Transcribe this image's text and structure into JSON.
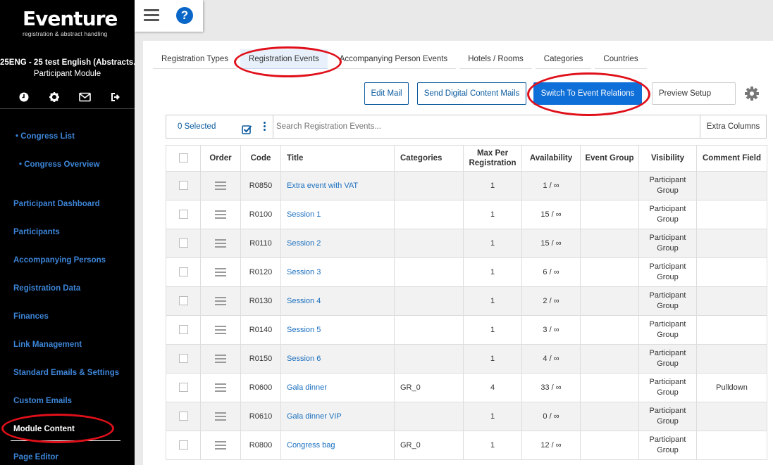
{
  "brand": {
    "name": "Eventure",
    "tagline": "registration & abstract handling"
  },
  "congress": {
    "title": "25ENG - 25 test English (Abstracts...",
    "module": "Participant Module"
  },
  "sidebar": {
    "icons": [
      "clock-icon",
      "gear-icon",
      "envelope-icon",
      "sign-out-icon"
    ],
    "items": [
      {
        "label": "• Congress List"
      },
      {
        "label": "• Congress Overview"
      },
      {
        "label": "Participant Dashboard"
      },
      {
        "label": "Participants"
      },
      {
        "label": "Accompanying Persons"
      },
      {
        "label": "Registration Data"
      },
      {
        "label": "Finances"
      },
      {
        "label": "Link Management"
      },
      {
        "label": "Standard Emails & Settings"
      },
      {
        "label": "Custom Emails"
      },
      {
        "label": "Module Content"
      },
      {
        "label": "Page Editor"
      }
    ],
    "active": "Module Content"
  },
  "topbar": {
    "help_label": "?"
  },
  "tabs": [
    {
      "label": "Registration Types"
    },
    {
      "label": "Registration Events",
      "active": true
    },
    {
      "label": "Accompanying Person Events"
    },
    {
      "label": "Hotels / Rooms"
    },
    {
      "label": "Categories"
    },
    {
      "label": "Countries"
    }
  ],
  "actions": {
    "edit_mail": "Edit Mail",
    "send_digital": "Send Digital Content Mails",
    "switch_relations": "Switch To Event Relations",
    "preview_setup": "Preview Setup"
  },
  "toolbar": {
    "selected": "0 Selected",
    "search_placeholder": "Search Registration Events...",
    "extra_columns": "Extra Columns"
  },
  "table": {
    "headers": {
      "order": "Order",
      "code": "Code",
      "title": "Title",
      "categories": "Categories",
      "max_per_registration": "Max Per Registration",
      "availability": "Availability",
      "event_group": "Event Group",
      "visibility": "Visibility",
      "comment_field": "Comment Field"
    },
    "rows": [
      {
        "code": "R0850",
        "title": "Extra event with VAT",
        "categories": "",
        "max": "1",
        "availability": "1 / ∞",
        "event_group": "",
        "visibility": "Participant Group",
        "comment": ""
      },
      {
        "code": "R0100",
        "title": "Session 1",
        "categories": "",
        "max": "1",
        "availability": "15 / ∞",
        "event_group": "",
        "visibility": "Participant Group",
        "comment": ""
      },
      {
        "code": "R0110",
        "title": "Session 2",
        "categories": "",
        "max": "1",
        "availability": "15 / ∞",
        "event_group": "",
        "visibility": "Participant Group",
        "comment": ""
      },
      {
        "code": "R0120",
        "title": "Session 3",
        "categories": "",
        "max": "1",
        "availability": "6 / ∞",
        "event_group": "",
        "visibility": "Participant Group",
        "comment": ""
      },
      {
        "code": "R0130",
        "title": "Session 4",
        "categories": "",
        "max": "1",
        "availability": "2 / ∞",
        "event_group": "",
        "visibility": "Participant Group",
        "comment": ""
      },
      {
        "code": "R0140",
        "title": "Session 5",
        "categories": "",
        "max": "1",
        "availability": "3 / ∞",
        "event_group": "",
        "visibility": "Participant Group",
        "comment": ""
      },
      {
        "code": "R0150",
        "title": "Session 6",
        "categories": "",
        "max": "1",
        "availability": "4 / ∞",
        "event_group": "",
        "visibility": "Participant Group",
        "comment": ""
      },
      {
        "code": "R0600",
        "title": "Gala dinner",
        "categories": "GR_0",
        "max": "4",
        "availability": "33 / ∞",
        "event_group": "",
        "visibility": "Participant Group",
        "comment": "Pulldown"
      },
      {
        "code": "R0610",
        "title": "Gala dinner VIP",
        "categories": "",
        "max": "1",
        "availability": "0 / ∞",
        "event_group": "",
        "visibility": "Participant Group",
        "comment": ""
      },
      {
        "code": "R0800",
        "title": "Congress bag",
        "categories": "GR_0",
        "max": "1",
        "availability": "12 / ∞",
        "event_group": "",
        "visibility": "Participant Group",
        "comment": ""
      }
    ]
  },
  "colors": {
    "accent": "#0f6fd8",
    "link": "#1a6fbf",
    "sidebar_bg": "#000000",
    "sidebar_link": "#3d85d8",
    "annotation": "#e0101a"
  }
}
